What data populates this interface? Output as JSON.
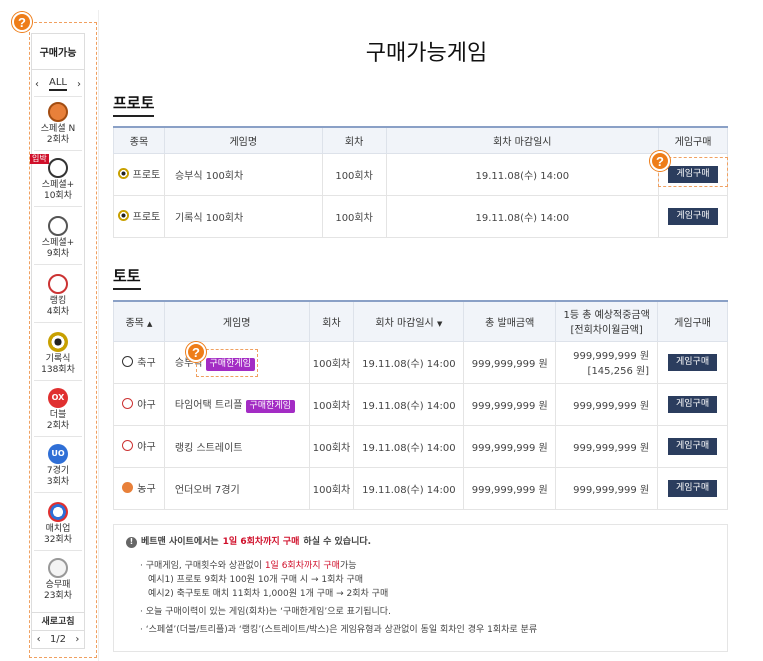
{
  "sidebar": {
    "title": "구매가능",
    "all_label": "ALL",
    "prev": "‹",
    "next": "›",
    "items": [
      {
        "label": "스페셜 N",
        "round": "2회차",
        "icon": "basketball-icon",
        "color": "#e8803a",
        "badge": ""
      },
      {
        "label": "스페셜+",
        "round": "10회차",
        "icon": "soccer-icon",
        "color": "#333333",
        "badge": "입박"
      },
      {
        "label": "스페셜+",
        "round": "9회차",
        "icon": "volleyball-icon",
        "color": "#555555",
        "badge": ""
      },
      {
        "label": "랭킹",
        "round": "4회차",
        "icon": "baseball-icon",
        "color": "#cc3333",
        "badge": ""
      },
      {
        "label": "기록식",
        "round": "138회차",
        "icon": "target-icon",
        "color": "#c8a000",
        "badge": ""
      },
      {
        "label": "더블",
        "round": "2회차",
        "icon": "ox-icon",
        "color": "#e03030",
        "badge": ""
      },
      {
        "label": "7경기",
        "round": "3회차",
        "icon": "uo-icon",
        "color": "#2f6fd6",
        "badge": ""
      },
      {
        "label": "매치업",
        "round": "32회차",
        "icon": "matchup-icon",
        "color": "#2f6fd6",
        "badge": ""
      },
      {
        "label": "승무패",
        "round": "23회차",
        "icon": "golf-ball-icon",
        "color": "#999999",
        "badge": ""
      }
    ],
    "refresh": "새로고침",
    "pager": {
      "prev": "‹",
      "page": "1/2",
      "next": "›"
    }
  },
  "main": {
    "title": "구매가능게임",
    "proto": {
      "title": "프로토",
      "headers": [
        "종목",
        "게임명",
        "회차",
        "회차 마감일시",
        "게임구매"
      ],
      "rows": [
        {
          "sport": "프로토",
          "name": "승부식 100회차",
          "round": "100회차",
          "deadline": "19.11.08(수) 14:00",
          "buy": "게임구매"
        },
        {
          "sport": "프로토",
          "name": "기록식 100회차",
          "round": "100회차",
          "deadline": "19.11.08(수) 14:00",
          "buy": "게임구매"
        }
      ]
    },
    "toto": {
      "title": "토토",
      "headers": {
        "sport": "종목",
        "name": "게임명",
        "round": "회차",
        "deadline": "회차 마감일시",
        "total": "총 발매금액",
        "expected": "1등 총 예상적중금액",
        "expected_sub": "[전회차이월금액]",
        "buy": "게임구매"
      },
      "sort_up": "▲",
      "sort_down": "▼",
      "rows": [
        {
          "sport": "축구",
          "name": "승부식",
          "tag": "구매한게임",
          "round": "100회차",
          "deadline": "19.11.08(수) 14:00",
          "total": "999,999,999 원",
          "expected": "999,999,999 원",
          "carry": "[145,256 원]",
          "buy": "게임구매"
        },
        {
          "sport": "야구",
          "name": "타임어택 트리플",
          "tag": "구매한게임",
          "round": "100회차",
          "deadline": "19.11.08(수) 14:00",
          "total": "999,999,999 원",
          "expected": "999,999,999 원",
          "carry": "",
          "buy": "게임구매"
        },
        {
          "sport": "야구",
          "name": "랭킹 스트레이트",
          "tag": "",
          "round": "100회차",
          "deadline": "19.11.08(수) 14:00",
          "total": "999,999,999 원",
          "expected": "999,999,999 원",
          "carry": "",
          "buy": "게임구매"
        },
        {
          "sport": "농구",
          "name": "언더오버 7경기",
          "tag": "",
          "round": "100회차",
          "deadline": "19.11.08(수) 14:00",
          "total": "999,999,999 원",
          "expected": "999,999,999 원",
          "carry": "",
          "buy": "게임구매"
        }
      ]
    },
    "notice": {
      "head_a": "베트맨 사이트에서는 ",
      "head_hl": "1일 6회차까지 구매",
      "head_b": "하실 수 있습니다.",
      "l1_a": "구매게임, 구매횟수와 상관없이 ",
      "l1_hl": "1일 6회차까지 구매",
      "l1_b": "가능",
      "ex1": "예시1) 프로토 9회차 100원 10개 구매 시 → 1회차 구매",
      "ex2": "예시2) 축구토토 매치 11회차 1,000원 1개 구매 → 2회차 구매",
      "l2": "오늘 구매이력이 있는 게임(회차)는 ‘구매한게임’으로 표기됩니다.",
      "l3": "‘스페셜’(더블/트리플)과 ‘랭킹’(스트레이트/박스)은 게임유형과 상관없이 동일 회차인 경우 1회차로 분류"
    },
    "help": "?"
  }
}
